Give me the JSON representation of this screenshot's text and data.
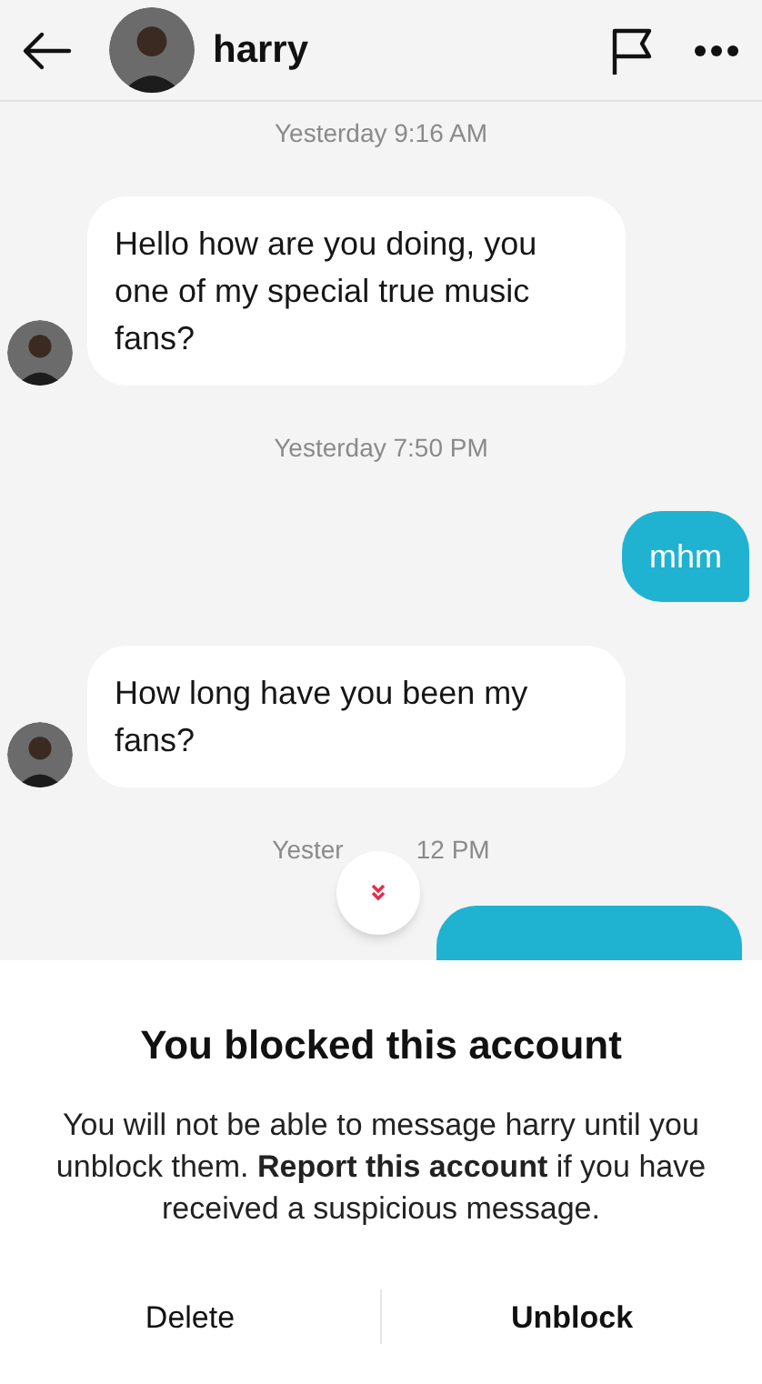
{
  "header": {
    "name": "harry"
  },
  "messages": [
    {
      "kind": "timestamp",
      "parts": [
        "Yesterday 9:16 AM"
      ]
    },
    {
      "kind": "incoming",
      "text": "Hello how are you doing, you one of my special true music fans?"
    },
    {
      "kind": "timestamp",
      "parts": [
        "Yesterday 7:50 PM"
      ]
    },
    {
      "kind": "outgoing",
      "text": "mhm"
    },
    {
      "kind": "incoming",
      "text": "How long have you been my fans?"
    },
    {
      "kind": "timestamp",
      "parts": [
        "Yester",
        "12 PM"
      ]
    },
    {
      "kind": "outgoing_cut"
    }
  ],
  "sheet": {
    "title": "You blocked this account",
    "body": "You will not be able to message harry until you unblock them. **Report this account** if you have received a suspicious message.",
    "buttons": [
      "Delete",
      "Unblock"
    ]
  }
}
